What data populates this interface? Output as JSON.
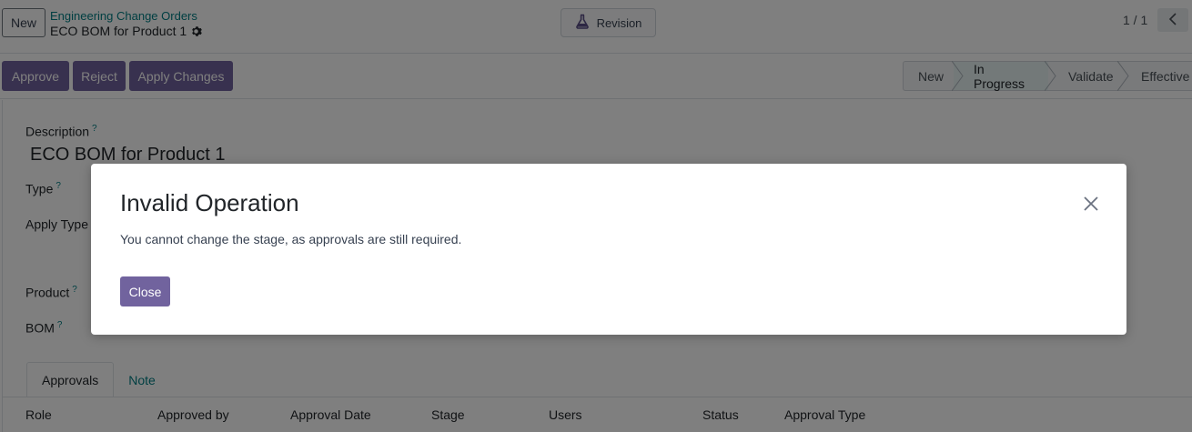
{
  "control_panel": {
    "new_label": "New",
    "breadcrumb": "Engineering Change Orders",
    "record_title": "ECO BOM for Product 1",
    "revision_label": "Revision",
    "pager": "1 / 1"
  },
  "statusbar": {
    "buttons": [
      "Approve",
      "Reject",
      "Apply Changes"
    ],
    "stages": [
      "New",
      "In Progress",
      "Validate",
      "Effective"
    ],
    "active_stage": "In Progress"
  },
  "form": {
    "description_label": "Description",
    "description_value": "ECO BOM for Product 1",
    "type_label": "Type",
    "apply_type_label": "Apply Type",
    "product_label": "Product",
    "bom_label": "BOM",
    "help_marker": "?"
  },
  "tabs": [
    "Approvals",
    "Note"
  ],
  "approvals_table": {
    "headers": [
      "Role",
      "Approved by",
      "Approval Date",
      "Stage",
      "Users",
      "Status",
      "Approval Type"
    ]
  },
  "dialog": {
    "title": "Invalid Operation",
    "message": "You cannot change the stage, as approvals are still required.",
    "close_label": "Close"
  },
  "colors": {
    "primary": "#71639e",
    "link": "#017e84",
    "backdrop": "rgba(0,0,0,0.5)"
  }
}
